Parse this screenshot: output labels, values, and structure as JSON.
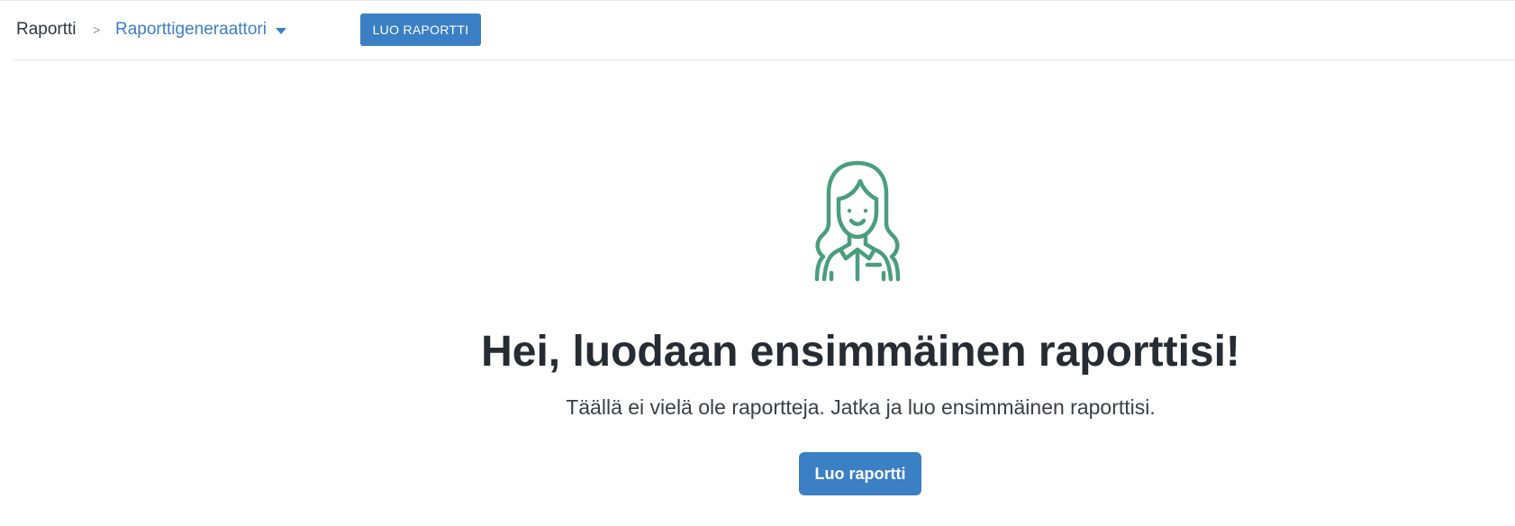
{
  "breadcrumb": {
    "root": "Raportti",
    "separator": ">",
    "current": "Raporttigeneraattori"
  },
  "toolbar": {
    "create_label": "LUO RAPORTTI"
  },
  "empty_state": {
    "illustration_icon": "woman-avatar-icon",
    "title": "Hei, luodaan ensimmäinen raporttisi!",
    "subtitle": "Täällä ei vielä ole raportteja. Jatka ja luo ensimmäinen raporttisi.",
    "button_label": "Luo raportti"
  },
  "colors": {
    "accent": "#3b7fc4",
    "illustration": "#4a9e7e",
    "heading": "#262c33"
  }
}
